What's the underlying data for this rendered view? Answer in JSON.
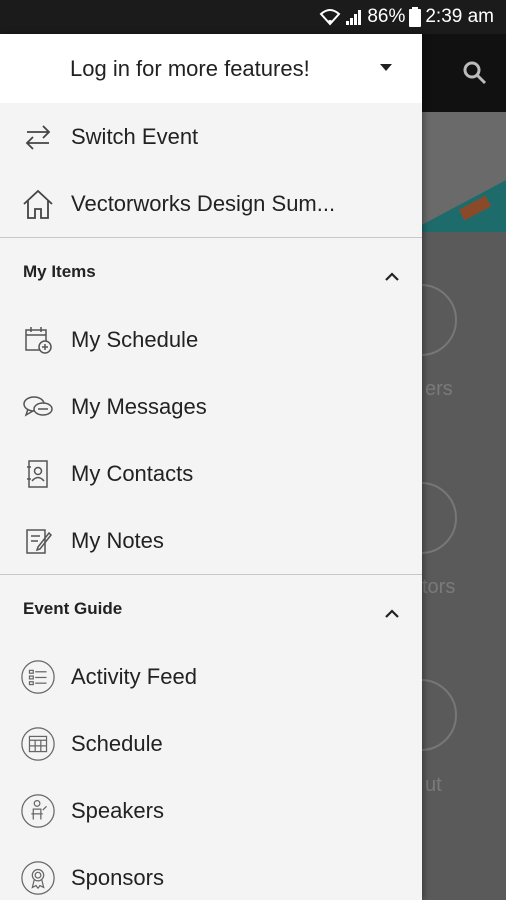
{
  "status_bar": {
    "battery": "86%",
    "time": "2:39 am",
    "icons": [
      "wifi-icon",
      "signal-icon",
      "battery-icon"
    ]
  },
  "drawer": {
    "header_label": "Log in for more features!",
    "top_items": [
      {
        "label": "Switch Event",
        "icon": "switch-arrows-icon"
      },
      {
        "label": "Vectorworks Design Sum...",
        "icon": "home-icon"
      }
    ],
    "sections": [
      {
        "title": "My Items",
        "items": [
          {
            "label": "My Schedule",
            "icon": "calendar-add-icon"
          },
          {
            "label": "My Messages",
            "icon": "chat-bubbles-icon"
          },
          {
            "label": "My Contacts",
            "icon": "contact-card-icon"
          },
          {
            "label": "My Notes",
            "icon": "note-edit-icon"
          }
        ]
      },
      {
        "title": "Event Guide",
        "items": [
          {
            "label": "Activity Feed",
            "icon": "activity-feed-icon"
          },
          {
            "label": "Schedule",
            "icon": "calendar-icon"
          },
          {
            "label": "Speakers",
            "icon": "speaker-icon"
          },
          {
            "label": "Sponsors",
            "icon": "ribbon-award-icon"
          }
        ]
      }
    ]
  },
  "background": {
    "tile_labels": [
      "ers",
      "tors",
      "ut"
    ]
  },
  "colors": {
    "drawer_bg": "#f4f4f4",
    "header_bg": "#ffffff",
    "status_bar": "#1b1b1b",
    "app_bar": "#111111",
    "accent_teal": "#1e6b6b"
  }
}
